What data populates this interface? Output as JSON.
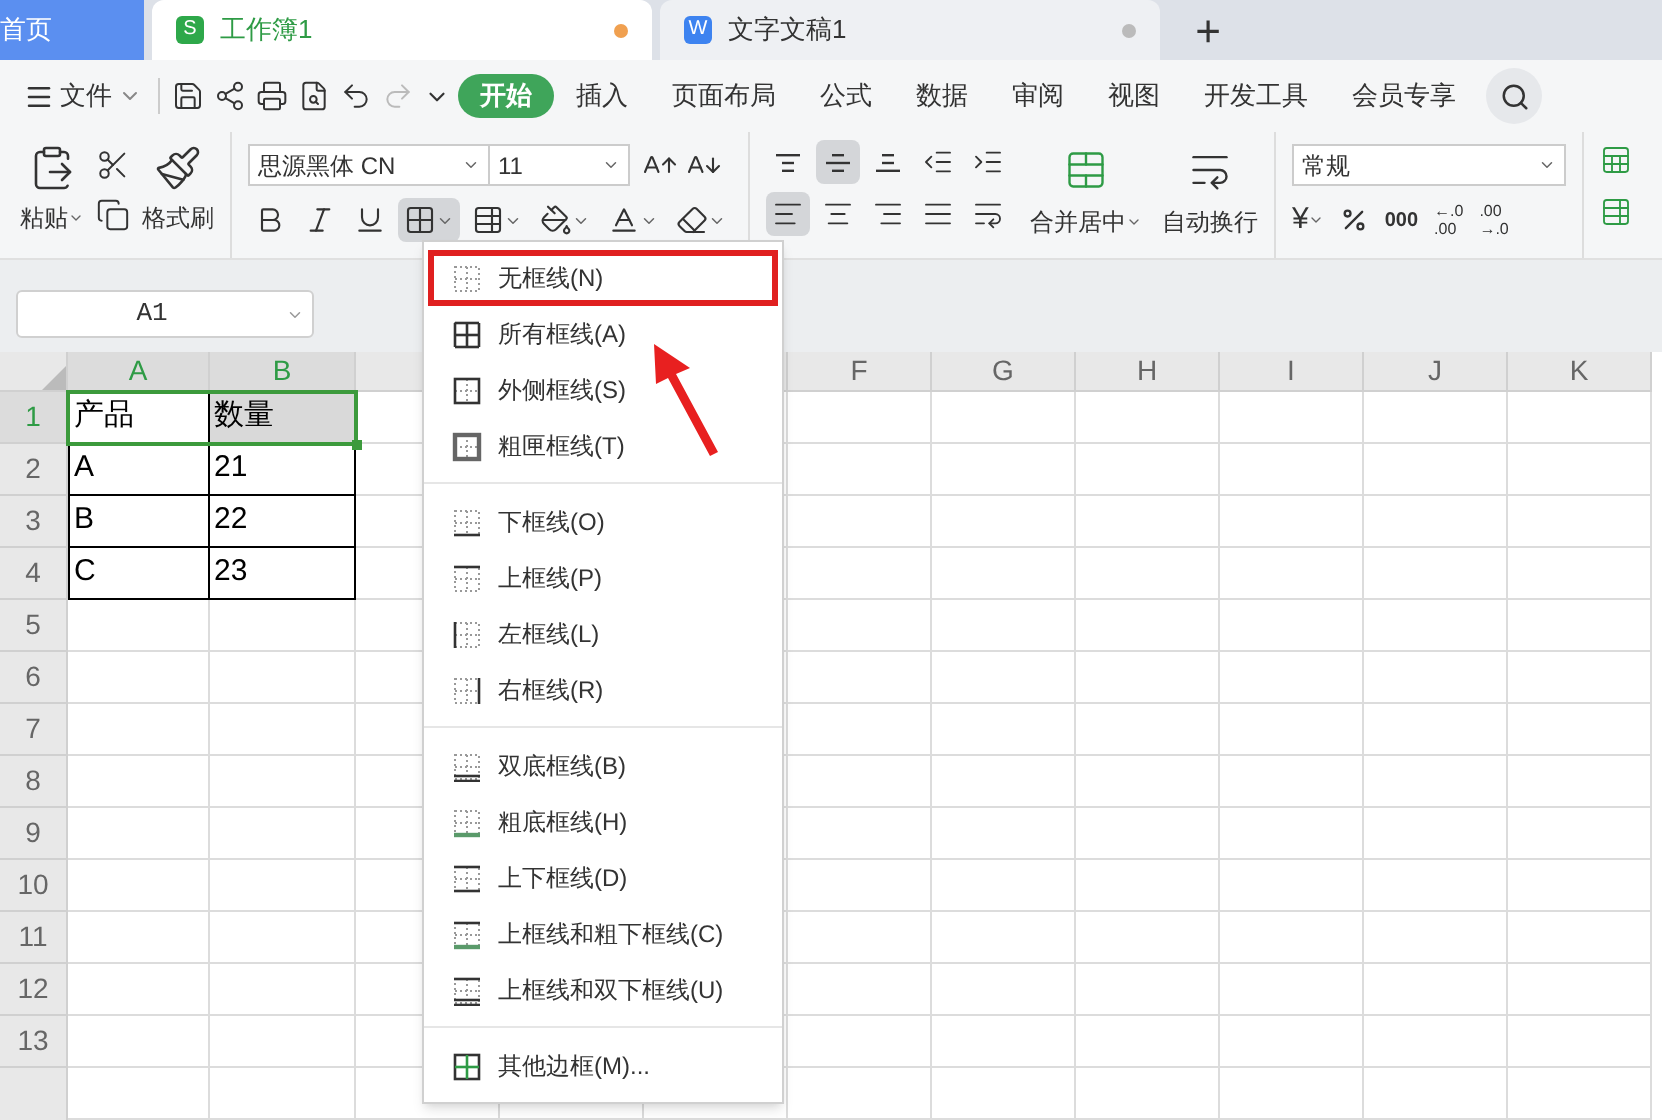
{
  "tabs": [
    {
      "kind": "home",
      "label": "首页",
      "selected": false
    },
    {
      "kind": "sheet",
      "badge": "S",
      "label": "工作簿1",
      "selected": true,
      "unsaved": true
    },
    {
      "kind": "doc",
      "badge": "W",
      "label": "文字文稿1",
      "selected": false,
      "unsaved": true
    }
  ],
  "new_tab": "+",
  "menu_bar": {
    "file": "文件",
    "tabs": [
      {
        "label": "开始",
        "selected": true
      },
      {
        "label": "插入",
        "selected": false
      },
      {
        "label": "页面布局",
        "selected": false
      },
      {
        "label": "公式",
        "selected": false
      },
      {
        "label": "数据",
        "selected": false
      },
      {
        "label": "审阅",
        "selected": false
      },
      {
        "label": "视图",
        "selected": false
      },
      {
        "label": "开发工具",
        "selected": false
      },
      {
        "label": "会员专享",
        "selected": false
      }
    ]
  },
  "ribbon": {
    "paste": "粘贴",
    "format_painter": "格式刷",
    "font": "思源黑体 CN",
    "font_size": "11",
    "border_active": true,
    "vertical_align": [
      {
        "kind": "top",
        "active": false
      },
      {
        "kind": "middle",
        "active": true
      },
      {
        "kind": "bottom",
        "active": false
      }
    ],
    "horizontal_align": [
      {
        "kind": "left",
        "active": true
      },
      {
        "kind": "center",
        "active": false
      },
      {
        "kind": "right",
        "active": false
      },
      {
        "kind": "justify",
        "active": false
      }
    ],
    "merge": "合并居中",
    "wrap": "自动换行",
    "number_format": "常规",
    "currency": "¥",
    "thousands": "000",
    "decimal_more": {
      "top": "←.0",
      "bottom": ".00"
    },
    "decimal_less": {
      "top": ".00",
      "bottom": "→.0"
    }
  },
  "name_box": "A1",
  "columns": [
    "A",
    "B",
    "F",
    "G",
    "H",
    "I",
    "J",
    "K"
  ],
  "rows": [
    {
      "header": "1",
      "cells": [
        "产品",
        "数量"
      ]
    },
    {
      "header": "2",
      "cells": [
        "A",
        "21"
      ]
    },
    {
      "header": "3",
      "cells": [
        "B",
        "22"
      ]
    },
    {
      "header": "4",
      "cells": [
        "C",
        "23"
      ]
    },
    {
      "header": "5",
      "cells": []
    },
    {
      "header": "6",
      "cells": []
    },
    {
      "header": "7",
      "cells": []
    },
    {
      "header": "8",
      "cells": []
    },
    {
      "header": "9",
      "cells": []
    },
    {
      "header": "10",
      "cells": []
    },
    {
      "header": "11",
      "cells": []
    },
    {
      "header": "12",
      "cells": []
    },
    {
      "header": "13",
      "cells": []
    }
  ],
  "border_menu": {
    "groups": [
      [
        {
          "kind": "none",
          "label": "无框线(N)",
          "annotated": true
        },
        {
          "kind": "all",
          "label": "所有框线(A)",
          "annotated": false
        },
        {
          "kind": "outside",
          "label": "外侧框线(S)",
          "annotated": false
        },
        {
          "kind": "thick_box",
          "label": "粗匣框线(T)",
          "annotated": false
        }
      ],
      [
        {
          "kind": "bottom",
          "label": "下框线(O)",
          "annotated": false
        },
        {
          "kind": "top",
          "label": "上框线(P)",
          "annotated": false
        },
        {
          "kind": "left",
          "label": "左框线(L)",
          "annotated": false
        },
        {
          "kind": "right",
          "label": "右框线(R)",
          "annotated": false
        }
      ],
      [
        {
          "kind": "double_bottom",
          "label": "双底框线(B)",
          "annotated": false
        },
        {
          "kind": "thick_bottom",
          "label": "粗底框线(H)",
          "annotated": false
        },
        {
          "kind": "top_bottom",
          "label": "上下框线(D)",
          "annotated": false
        },
        {
          "kind": "top_thick_bottom",
          "label": "上框线和粗下框线(C)",
          "annotated": false
        },
        {
          "kind": "top_double_bottom",
          "label": "上框线和双下框线(U)",
          "annotated": false
        }
      ],
      [
        {
          "kind": "more",
          "label": "其他边框(M)...",
          "annotated": false
        }
      ]
    ]
  }
}
